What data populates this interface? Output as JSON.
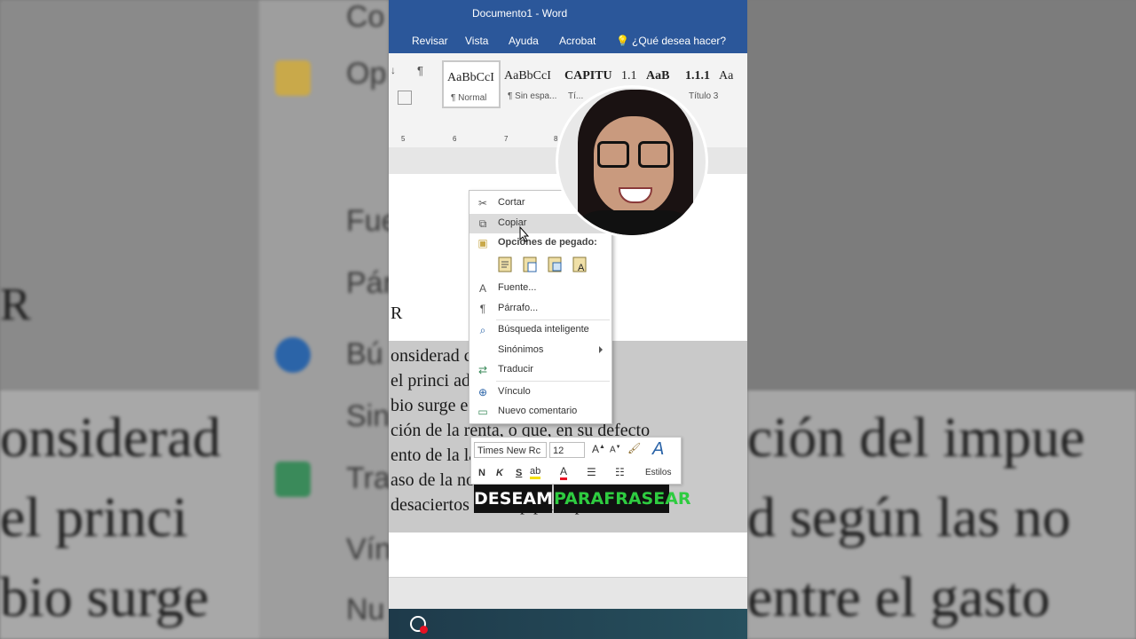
{
  "window": {
    "title": "Documento1  -  Word"
  },
  "menu": {
    "items": [
      "Revisar",
      "Vista",
      "Ayuda",
      "Acrobat"
    ],
    "tell_me": "¿Qué desea hacer?"
  },
  "ribbon": {
    "styles": [
      {
        "preview": "AaBbCcI",
        "name": "¶ Normal"
      },
      {
        "preview": "AaBbCcI",
        "name": "¶ Sin espa..."
      },
      {
        "preview": "CAPITU",
        "name": "Tí..."
      },
      {
        "preview": "1.1",
        "name": ""
      },
      {
        "preview": "AaB",
        "name": ""
      },
      {
        "preview": "1.1.1",
        "name": "Título 3"
      },
      {
        "preview": "Aa",
        "name": ""
      }
    ]
  },
  "ruler": [
    "5",
    "6",
    "7",
    "8"
  ],
  "document": {
    "heading_fragment": "R",
    "lines": [
      "onsiderad                              cción del impue",
      "el princi                              ad según las no",
      "bio surge                              entre el gasto",
      "ción de la renta, o que, en su defecto",
      "ento de la                             la renta",
      "aso de la no                           bio y po",
      "desaciertos en la ap                   principio."
    ]
  },
  "context_menu": {
    "cut": "Cortar",
    "copy": "Copiar",
    "paste_options": "Opciones de pegado:",
    "font": "Fuente...",
    "paragraph": "Párrafo...",
    "smart_lookup": "Búsqueda inteligente",
    "synonyms": "Sinónimos",
    "translate": "Traducir",
    "link": "Vínculo",
    "new_comment": "Nuevo comentario"
  },
  "mini_toolbar": {
    "font_name": "Times New Rc",
    "font_size": "12",
    "bold": "N",
    "italic": "K",
    "underline": "S",
    "styles_label": "Estilos"
  },
  "caption": {
    "word1": "DESEAMOS",
    "word2": "PARAFRASEAR",
    "word2_color": "#2ecc40"
  },
  "background": {
    "left_letter": "R",
    "left_menu": [
      "Co",
      "Op",
      "Fue",
      "Pár",
      "Bú",
      "Sin",
      "Tra",
      "Vín",
      "Nu"
    ],
    "big_lines": [
      "onsiderad",
      "el princi",
      "bio surge"
    ],
    "right_lines": [
      "ción del impue",
      "d según las no",
      "entre el gasto"
    ]
  },
  "colors": {
    "titlebar": "#2b579a",
    "caption_bg": "#111111"
  }
}
